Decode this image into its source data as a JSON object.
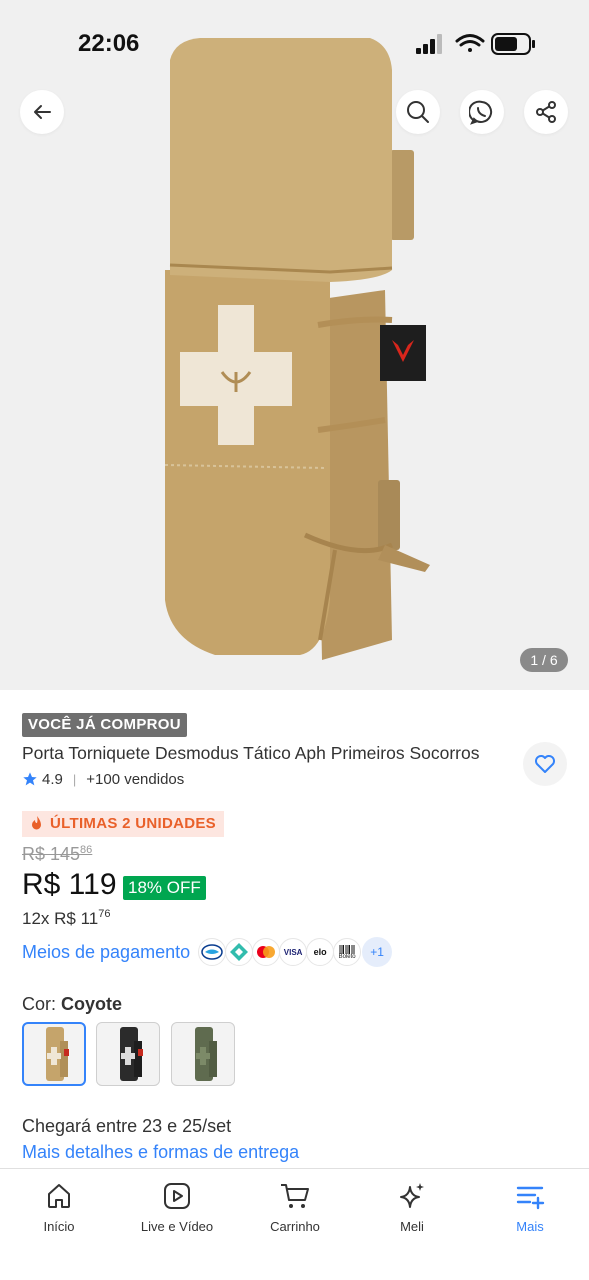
{
  "status_bar": {
    "time": "22:06"
  },
  "gallery": {
    "counter": "1 / 6"
  },
  "product": {
    "badge": "VOCÊ JÁ COMPROU",
    "title": "Porta Torniquete Desmodus Tático Aph Primeiros Socorros",
    "rating": "4.9",
    "sold": "+100 vendidos",
    "stock_alert": "ÚLTIMAS 2 UNIDADES",
    "old_price_main": "R$ 145",
    "old_price_cents": "86",
    "price": "R$ 119",
    "discount": "18% OFF",
    "installments_main": "12x R$ 11",
    "installments_cents": "76",
    "payment_link": "Meios de pagamento",
    "payment_methods": [
      "mercado-pago-icon",
      "pix-icon",
      "mastercard-icon",
      "visa-icon",
      "elo-icon",
      "boleto-icon"
    ],
    "payment_visa": "VISA",
    "payment_elo": "elo",
    "payment_boleto": "Boleto",
    "payment_more": "+1",
    "color_prefix": "Cor:",
    "color_selected": "Coyote"
  },
  "shipping": {
    "estimate": "Chegará entre 23 e 25/set",
    "details_link": "Mais detalhes e formas de entrega"
  },
  "tabbar": {
    "tabs": [
      {
        "label": "Início",
        "icon": "home-icon"
      },
      {
        "label": "Live e Vídeo",
        "icon": "play-icon"
      },
      {
        "label": "Carrinho",
        "icon": "cart-icon"
      },
      {
        "label": "Meli",
        "icon": "sparkle-icon"
      },
      {
        "label": "Mais",
        "icon": "menu-plus-icon"
      }
    ]
  },
  "colors": {
    "accent": "#3483fa",
    "discount": "#00a650",
    "alert": "#e9602a",
    "product": "#c5a46b"
  }
}
